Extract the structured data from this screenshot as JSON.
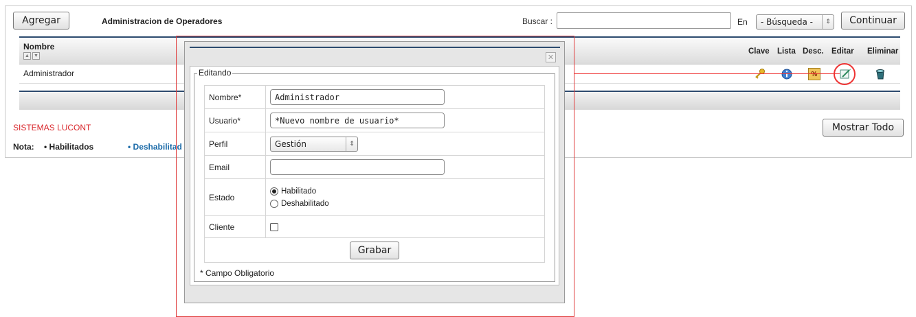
{
  "toolbar": {
    "add_label": "Agregar",
    "title": "Administracion de Operadores",
    "search_label": "Buscar :",
    "search_value": "",
    "in_label": "En",
    "field_select": "- Búsqueda -",
    "continue_label": "Continuar"
  },
  "grid": {
    "columns": [
      "Nombre",
      "Clave",
      "Lista",
      "Desc.",
      "Editar",
      "Eliminar"
    ],
    "rows": [
      {
        "nombre": "Administrador"
      }
    ],
    "icons": [
      "key-icon",
      "info-icon",
      "percent-icon",
      "edit-icon",
      "delete-icon"
    ],
    "percent_glyph": "%"
  },
  "footer": {
    "company": "SISTEMAS LUCONT",
    "nota_label": "Nota:",
    "habilitados": "• Habilitados",
    "deshabilitados": "• Deshabilitad",
    "show_all_label": "Mostrar Todo"
  },
  "dialog": {
    "legend": "Editando",
    "close_glyph": "✕",
    "fields": {
      "nombre_label": "Nombre*",
      "nombre_value": "Administrador",
      "usuario_label": "Usuario*",
      "usuario_value": "*Nuevo nombre de usuario*",
      "perfil_label": "Perfil",
      "perfil_value": "Gestión",
      "email_label": "Email",
      "email_value": "",
      "estado_label": "Estado",
      "estado_opt1": "Habilitado",
      "estado_opt2": "Deshabilitado",
      "cliente_label": "Cliente"
    },
    "save_label": "Grabar",
    "footnote": "* Campo Obligatorio"
  },
  "colors": {
    "accent_line": "#2c4a6e",
    "company_red": "#d9262b",
    "callout_red": "#e33333",
    "link_blue": "#1a6aa8"
  }
}
